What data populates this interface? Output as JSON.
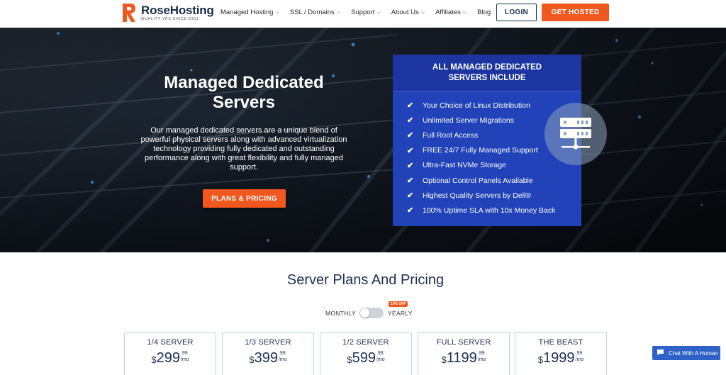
{
  "brand": {
    "name": "RoseHosting",
    "tagline": "QUALITY VPS SINCE 2001",
    "accent": "#f1581f",
    "navy": "#1f2f52"
  },
  "nav": {
    "items": [
      {
        "label": "Managed Hosting",
        "dropdown": true
      },
      {
        "label": "SSL / Domains",
        "dropdown": true
      },
      {
        "label": "Support",
        "dropdown": true
      },
      {
        "label": "About Us",
        "dropdown": true
      },
      {
        "label": "Affiliates",
        "dropdown": true
      },
      {
        "label": "Blog",
        "dropdown": false
      }
    ],
    "login": "LOGIN",
    "get_hosted": "GET HOSTED"
  },
  "hero": {
    "title": "Managed Dedicated Servers",
    "description": "Our managed dedicated servers are a unique blend of powerful physical servers along with advanced virtualization technology providing fully dedicated and outstanding performance along with great flexibility and fully managed support.",
    "cta": "PLANS & PRICING"
  },
  "panel": {
    "heading": "ALL MANAGED DEDICATED SERVERS INCLUDE",
    "features": [
      "Your Choice of Linux Distribution",
      "Unlimited Server Migrations",
      "Full Root Access",
      "FREE 24/7 Fully Managed Support",
      "Ultra-Fast NVMe Storage",
      "Optional Control Panels Available",
      "Highest Quality Servers by Dell®",
      "100% Uptime SLA with 10x Money Back"
    ],
    "icon": "server-rack-icon",
    "color": "#2142b8"
  },
  "pricing": {
    "title": "Server Plans And Pricing",
    "toggle": {
      "monthly": "MONTHLY",
      "yearly": "YEARLY",
      "badge": "10% OFF",
      "selected": "MONTHLY"
    },
    "plans": [
      {
        "name": "1/4 SERVER",
        "currency": "$",
        "amount": "299",
        "cents": ".99",
        "period": "/mo"
      },
      {
        "name": "1/3 SERVER",
        "currency": "$",
        "amount": "399",
        "cents": ".99",
        "period": "/mo"
      },
      {
        "name": "1/2 SERVER",
        "currency": "$",
        "amount": "599",
        "cents": ".99",
        "period": "/mo"
      },
      {
        "name": "FULL SERVER",
        "currency": "$",
        "amount": "1199",
        "cents": ".99",
        "period": "/mo"
      },
      {
        "name": "THE BEAST",
        "currency": "$",
        "amount": "1999",
        "cents": ".99",
        "period": "/mo"
      }
    ]
  },
  "chat": {
    "label": "Chat With A Human",
    "icon": "chat-bubble-icon"
  }
}
